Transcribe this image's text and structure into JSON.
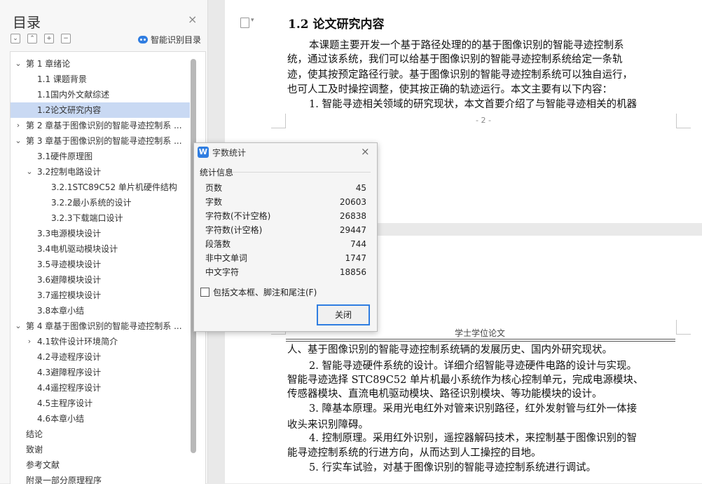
{
  "sidebar": {
    "title": "目录",
    "close_icon": "×",
    "toolbar": [
      "⌄",
      "⌃",
      "+",
      "−"
    ],
    "smart_toc_label": "智能识别目录",
    "items": [
      {
        "label": "第 1 章绪论",
        "level": 0,
        "expand": "open"
      },
      {
        "label": "1.1  课题背景",
        "level": 1,
        "expand": "none"
      },
      {
        "label": "1.1国内外文献综述",
        "level": 1,
        "expand": "none"
      },
      {
        "label": "1.2论文研究内容",
        "level": 1,
        "expand": "none",
        "selected": true
      },
      {
        "label": "第 2 章基于图像识别的智能寻迹控制系 ...",
        "level": 0,
        "expand": "closed"
      },
      {
        "label": "第 3 章基于图像识别的智能寻迹控制系 ...",
        "level": 0,
        "expand": "open"
      },
      {
        "label": "3.1硬件原理图",
        "level": 1,
        "expand": "none"
      },
      {
        "label": "3.2控制电路设计",
        "level": 1,
        "expand": "open"
      },
      {
        "label": "3.2.1STC89C52 单片机硬件结构",
        "level": 2,
        "expand": "none"
      },
      {
        "label": "3.2.2最小系统的设计",
        "level": 2,
        "expand": "none"
      },
      {
        "label": "3.2.3下载端口设计",
        "level": 2,
        "expand": "none"
      },
      {
        "label": "3.3电源模块设计",
        "level": 1,
        "expand": "none"
      },
      {
        "label": "3.4电机驱动模块设计",
        "level": 1,
        "expand": "none"
      },
      {
        "label": "3.5寻迹模块设计",
        "level": 1,
        "expand": "none"
      },
      {
        "label": "3.6避障模块设计",
        "level": 1,
        "expand": "none"
      },
      {
        "label": "3.7遥控模块设计",
        "level": 1,
        "expand": "none"
      },
      {
        "label": "3.8本章小结",
        "level": 1,
        "expand": "none"
      },
      {
        "label": "第 4 章基于图像识别的智能寻迹控制系 ...",
        "level": 0,
        "expand": "open"
      },
      {
        "label": "4.1软件设计环境简介",
        "level": 1,
        "expand": "closed"
      },
      {
        "label": "4.2寻迹程序设计",
        "level": 1,
        "expand": "none"
      },
      {
        "label": "4.3避障程序设计",
        "level": 1,
        "expand": "none"
      },
      {
        "label": "4.4遥控程序设计",
        "level": 1,
        "expand": "none"
      },
      {
        "label": "4.5主程序设计",
        "level": 1,
        "expand": "none"
      },
      {
        "label": "4.6本章小结",
        "level": 1,
        "expand": "none"
      },
      {
        "label": "结论",
        "level": 0,
        "expand": "none"
      },
      {
        "label": "致谢",
        "level": 0,
        "expand": "none"
      },
      {
        "label": "参考文献",
        "level": 0,
        "expand": "none"
      },
      {
        "label": "附录一部分原理程序",
        "level": 0,
        "expand": "none"
      }
    ]
  },
  "document": {
    "heading": "1.2  论文研究内容",
    "page1_lines": [
      "本课题主要开发一个基于路径处理的的基于图像识别的智能寻迹控制系",
      "统，通过该系统，我们可以给基于图像识别的智能寻迹控制系统给定一条轨",
      "迹，使其按预定路径行驶。基于图像识别的智能寻迹控制系统可以独自运行，",
      "也可人工及时操控调整，使其按正确的轨迹运行。本文主要有以下内容：",
      "1. 智能寻迹相关领域的研究现状，本文首要介绍了与智能寻迹相关的机器"
    ],
    "page_number": "- 2 -",
    "footer_label": "学士学位论文",
    "page2_lines": [
      "人、基于图像识别的智能寻迹控制系统辆的发展历史、国内外研究现状。",
      "2. 智能寻迹硬件系统的设计。详细介绍智能寻迹硬件电路的设计与实现。",
      "智能寻迹选择 STC89C52 单片机最小系统作为核心控制单元，完成电源模块、",
      "传感器模块、直流电机驱动模块、路径识别模块、等功能模块的设计。",
      "3. 障基本原理。采用光电红外对管来识别路径，红外发射管与红外一体接",
      "收头来识别障碍。",
      "4. 控制原理。采用红外识别，遥控器解码技术，来控制基于图像识别的智",
      "能寻迹控制系统的行进方向，从而达到人工操控的目地。",
      "5. 行实车试验，对基于图像识别的智能寻迹控制系统进行调试。"
    ]
  },
  "dialog": {
    "app_icon": "W",
    "title": "字数统计",
    "close_icon": "×",
    "section": "统计信息",
    "stats": [
      {
        "label": "页数",
        "value": "45"
      },
      {
        "label": "字数",
        "value": "20603"
      },
      {
        "label": "字符数(不计空格)",
        "value": "26838"
      },
      {
        "label": "字符数(计空格)",
        "value": "29447"
      },
      {
        "label": "段落数",
        "value": "744"
      },
      {
        "label": "非中文单词",
        "value": "1747"
      },
      {
        "label": "中文字符",
        "value": "18856"
      }
    ],
    "checkbox_label": "包括文本框、脚注和尾注(F)",
    "checkbox_checked": false,
    "close_button": "关闭"
  }
}
